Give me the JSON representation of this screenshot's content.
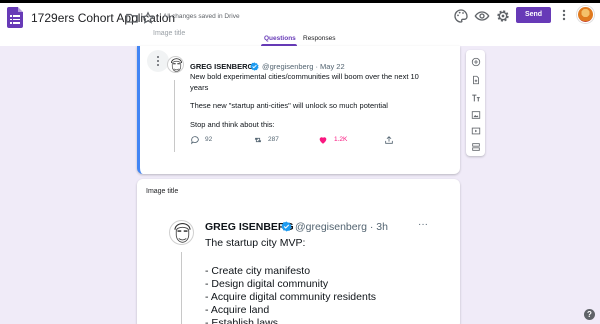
{
  "header": {
    "title": "1729ers Cohort Application",
    "saved_status": "All changes saved in Drive",
    "send_label": "Send",
    "icons": [
      "folder-icon",
      "star-icon",
      "palette-icon",
      "preview-eye-icon",
      "settings-icon",
      "more-vert-icon"
    ]
  },
  "tabs": [
    {
      "label": "Questions",
      "active": true
    },
    {
      "label": "Responses",
      "active": false
    }
  ],
  "colors": {
    "accent": "#673ab7",
    "focus_bar": "#4285f4",
    "background": "#f0ebf8",
    "like": "#f91880"
  },
  "question1": {
    "faint_title": "Image title",
    "tweet": {
      "name": "GREG ISENBERG",
      "handle": "@gregisenberg · May 22",
      "lines": [
        "New bold experimental cities/communities will boom over the next 10",
        "years",
        "These new \"startup anti-cities\" will unlock so much potential",
        "Stop and think about this:"
      ],
      "replies": "92",
      "retweets": "287",
      "likes": "1.2K"
    }
  },
  "question2": {
    "title": "Image title",
    "tweet": {
      "name": "GREG ISENBERG",
      "handle": "@gregisenberg · 3h",
      "more": "···",
      "lines": [
        "The startup city MVP:",
        "- Create city manifesto",
        "- Design digital community",
        "- Acquire digital community residents",
        "- Acquire land",
        "- Establish laws"
      ]
    }
  },
  "side_toolbar": [
    "add-question-icon",
    "import-questions-icon",
    "add-title-icon",
    "add-image-icon",
    "add-video-icon",
    "add-section-icon"
  ],
  "help_label": "?"
}
